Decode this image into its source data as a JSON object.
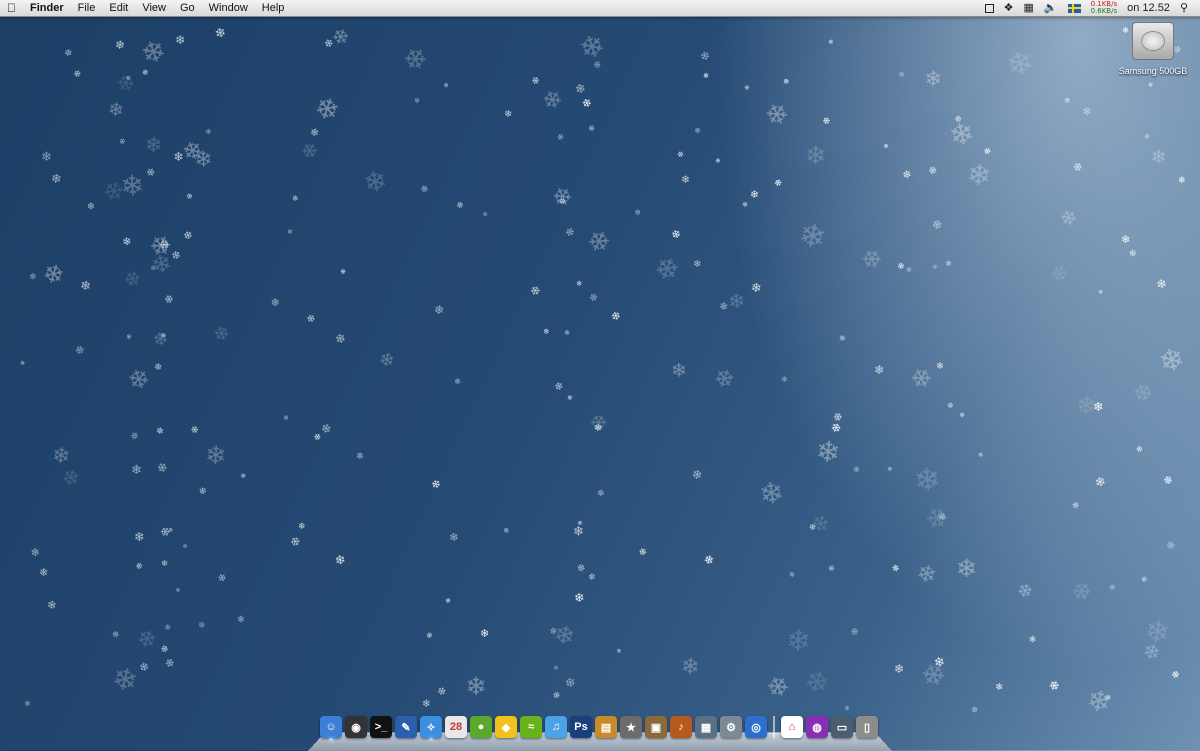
{
  "menubar": {
    "apple_icon": "apple-icon",
    "app_name": "Finder",
    "menus": [
      "File",
      "Edit",
      "View",
      "Go",
      "Window",
      "Help"
    ],
    "net_up": "0.1KB/s",
    "net_down": "0.6KB/s",
    "clock": "on 12.52"
  },
  "desktop": {
    "drive_label": "Samsung 500GB"
  },
  "dock": {
    "items": [
      {
        "icon": "finder-icon",
        "color": "#3b7fd6",
        "glyph": "☺"
      },
      {
        "icon": "dashboard-icon",
        "color": "#333333",
        "glyph": "◉"
      },
      {
        "icon": "terminal-icon",
        "color": "#111111",
        "glyph": ">_"
      },
      {
        "icon": "preview-icon",
        "color": "#2a5fae",
        "glyph": "✎"
      },
      {
        "icon": "safari-icon",
        "color": "#3b8fe0",
        "glyph": "✧"
      },
      {
        "icon": "ical-icon",
        "color": "#e8e8e8",
        "glyph": "28"
      },
      {
        "icon": "adium-icon",
        "color": "#5ba82a",
        "glyph": "●"
      },
      {
        "icon": "cyberduck-icon",
        "color": "#f1c21b",
        "glyph": "◆"
      },
      {
        "icon": "spotify-icon",
        "color": "#67b31b",
        "glyph": "≈"
      },
      {
        "icon": "itunes-icon",
        "color": "#4aa2e8",
        "glyph": "♫"
      },
      {
        "icon": "photoshop-icon",
        "color": "#1a3f7a",
        "glyph": "Ps"
      },
      {
        "icon": "notes-icon",
        "color": "#c98b2a",
        "glyph": "▤"
      },
      {
        "icon": "imovie-icon",
        "color": "#6b6b6b",
        "glyph": "★"
      },
      {
        "icon": "iphoto-icon",
        "color": "#8a6a3a",
        "glyph": "▣"
      },
      {
        "icon": "garageband-icon",
        "color": "#b45a1e",
        "glyph": "♪"
      },
      {
        "icon": "spaces-icon",
        "color": "#5b6f85",
        "glyph": "▦"
      },
      {
        "icon": "system-preferences-icon",
        "color": "#7d8a96",
        "glyph": "⚙"
      },
      {
        "icon": "dvd-player-icon",
        "color": "#2c6fcf",
        "glyph": "◎"
      },
      {
        "icon": "home-folder-icon",
        "color": "#ffffff",
        "glyph": "⌂"
      },
      {
        "icon": "podcast-icon",
        "color": "#8a2fb5",
        "glyph": "◍"
      },
      {
        "icon": "screen-sharing-icon",
        "color": "#4b5d70",
        "glyph": "▭"
      },
      {
        "icon": "trash-icon",
        "color": "#8c8c8c",
        "glyph": "▯"
      }
    ],
    "running": [
      0,
      4
    ]
  }
}
